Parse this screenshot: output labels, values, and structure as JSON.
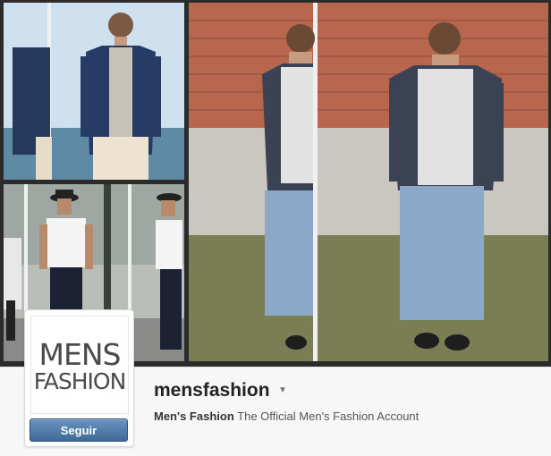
{
  "profile": {
    "logo_line1": "MENS",
    "logo_line2": "FASHION",
    "username": "mensfashion",
    "full_name": "Men's Fashion",
    "bio": " The Official Men's Fashion Account",
    "follow_label": "Seguir",
    "dropdown_icon": "caret-down-icon"
  },
  "photos": [
    {
      "subject": "man in navy blazer at seaside"
    },
    {
      "subject": "man in black fedora and white tee on street"
    },
    {
      "subject": "man in charcoal blazer and light jeans by brick wall"
    }
  ],
  "colors": {
    "follow_button": "#4a76a3",
    "username_text": "#222222",
    "bar_background": "#f7f7f7"
  }
}
